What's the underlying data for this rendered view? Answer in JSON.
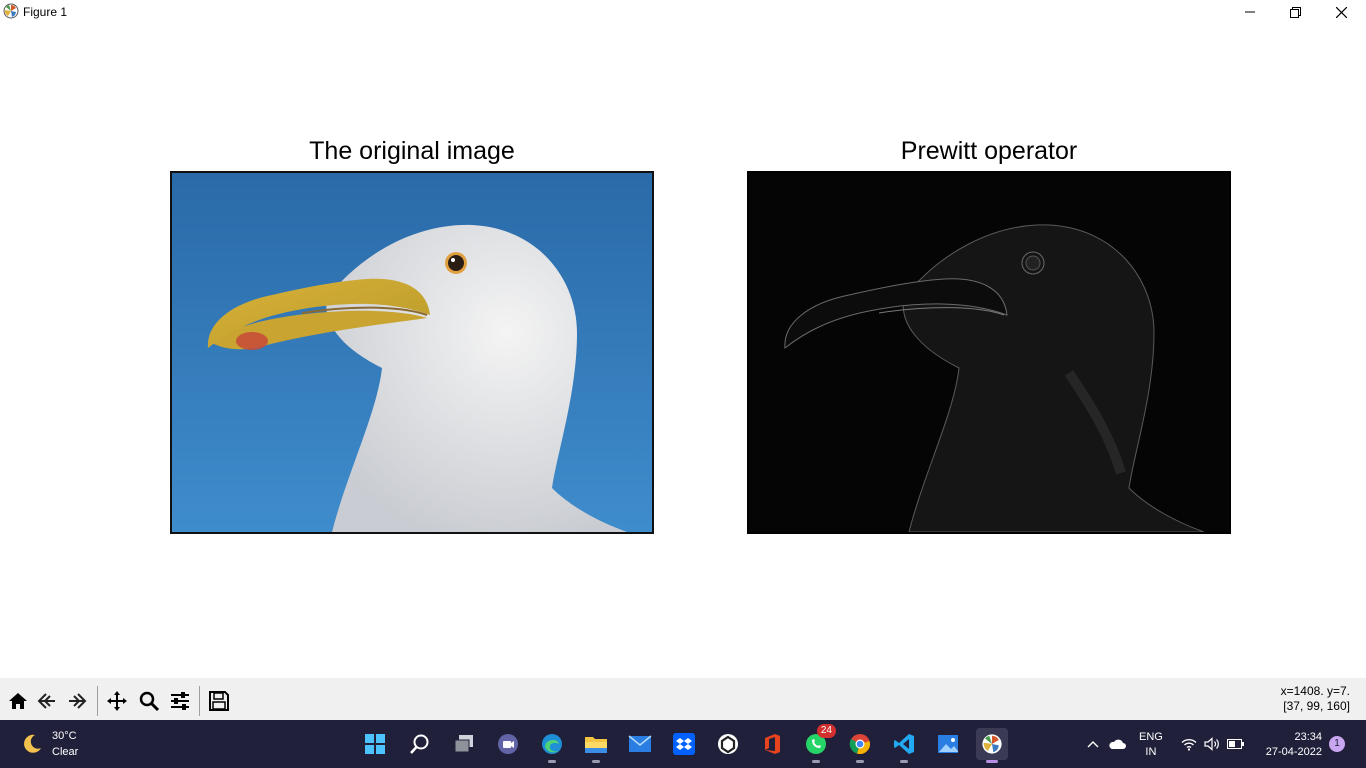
{
  "window": {
    "title": "Figure 1",
    "controls": [
      "minimize-icon",
      "restore-icon",
      "close-icon"
    ]
  },
  "figure": {
    "axes": [
      {
        "title": "The original image",
        "image": "seagull head in profile against blue sky"
      },
      {
        "title": "Prewitt operator",
        "image": "dark edge-detection map of seagull head"
      }
    ]
  },
  "toolbar": {
    "buttons": [
      "home-icon",
      "back-icon",
      "forward-icon",
      "pan-icon",
      "zoom-icon",
      "configure-subplots-icon",
      "save-icon"
    ],
    "coord_line1": "x=1408. y=7.",
    "coord_line2": "[37, 99, 160]"
  },
  "taskbar": {
    "weather": {
      "temp": "30°C",
      "condition": "Clear",
      "icon": "moon-icon"
    },
    "apps": [
      {
        "name": "start-icon"
      },
      {
        "name": "search-icon"
      },
      {
        "name": "task-view-icon"
      },
      {
        "name": "chat-icon"
      },
      {
        "name": "edge-icon"
      },
      {
        "name": "file-explorer-icon"
      },
      {
        "name": "mail-icon"
      },
      {
        "name": "dropbox-icon"
      },
      {
        "name": "app-icon"
      },
      {
        "name": "office-icon"
      },
      {
        "name": "whatsapp-icon",
        "badge": "24"
      },
      {
        "name": "chrome-icon"
      },
      {
        "name": "vscode-icon"
      },
      {
        "name": "photos-icon"
      },
      {
        "name": "matplotlib-icon",
        "active": true
      }
    ],
    "lang_line1": "ENG",
    "lang_line2": "IN",
    "time": "23:34",
    "date": "27-04-2022",
    "notifications": "1"
  }
}
